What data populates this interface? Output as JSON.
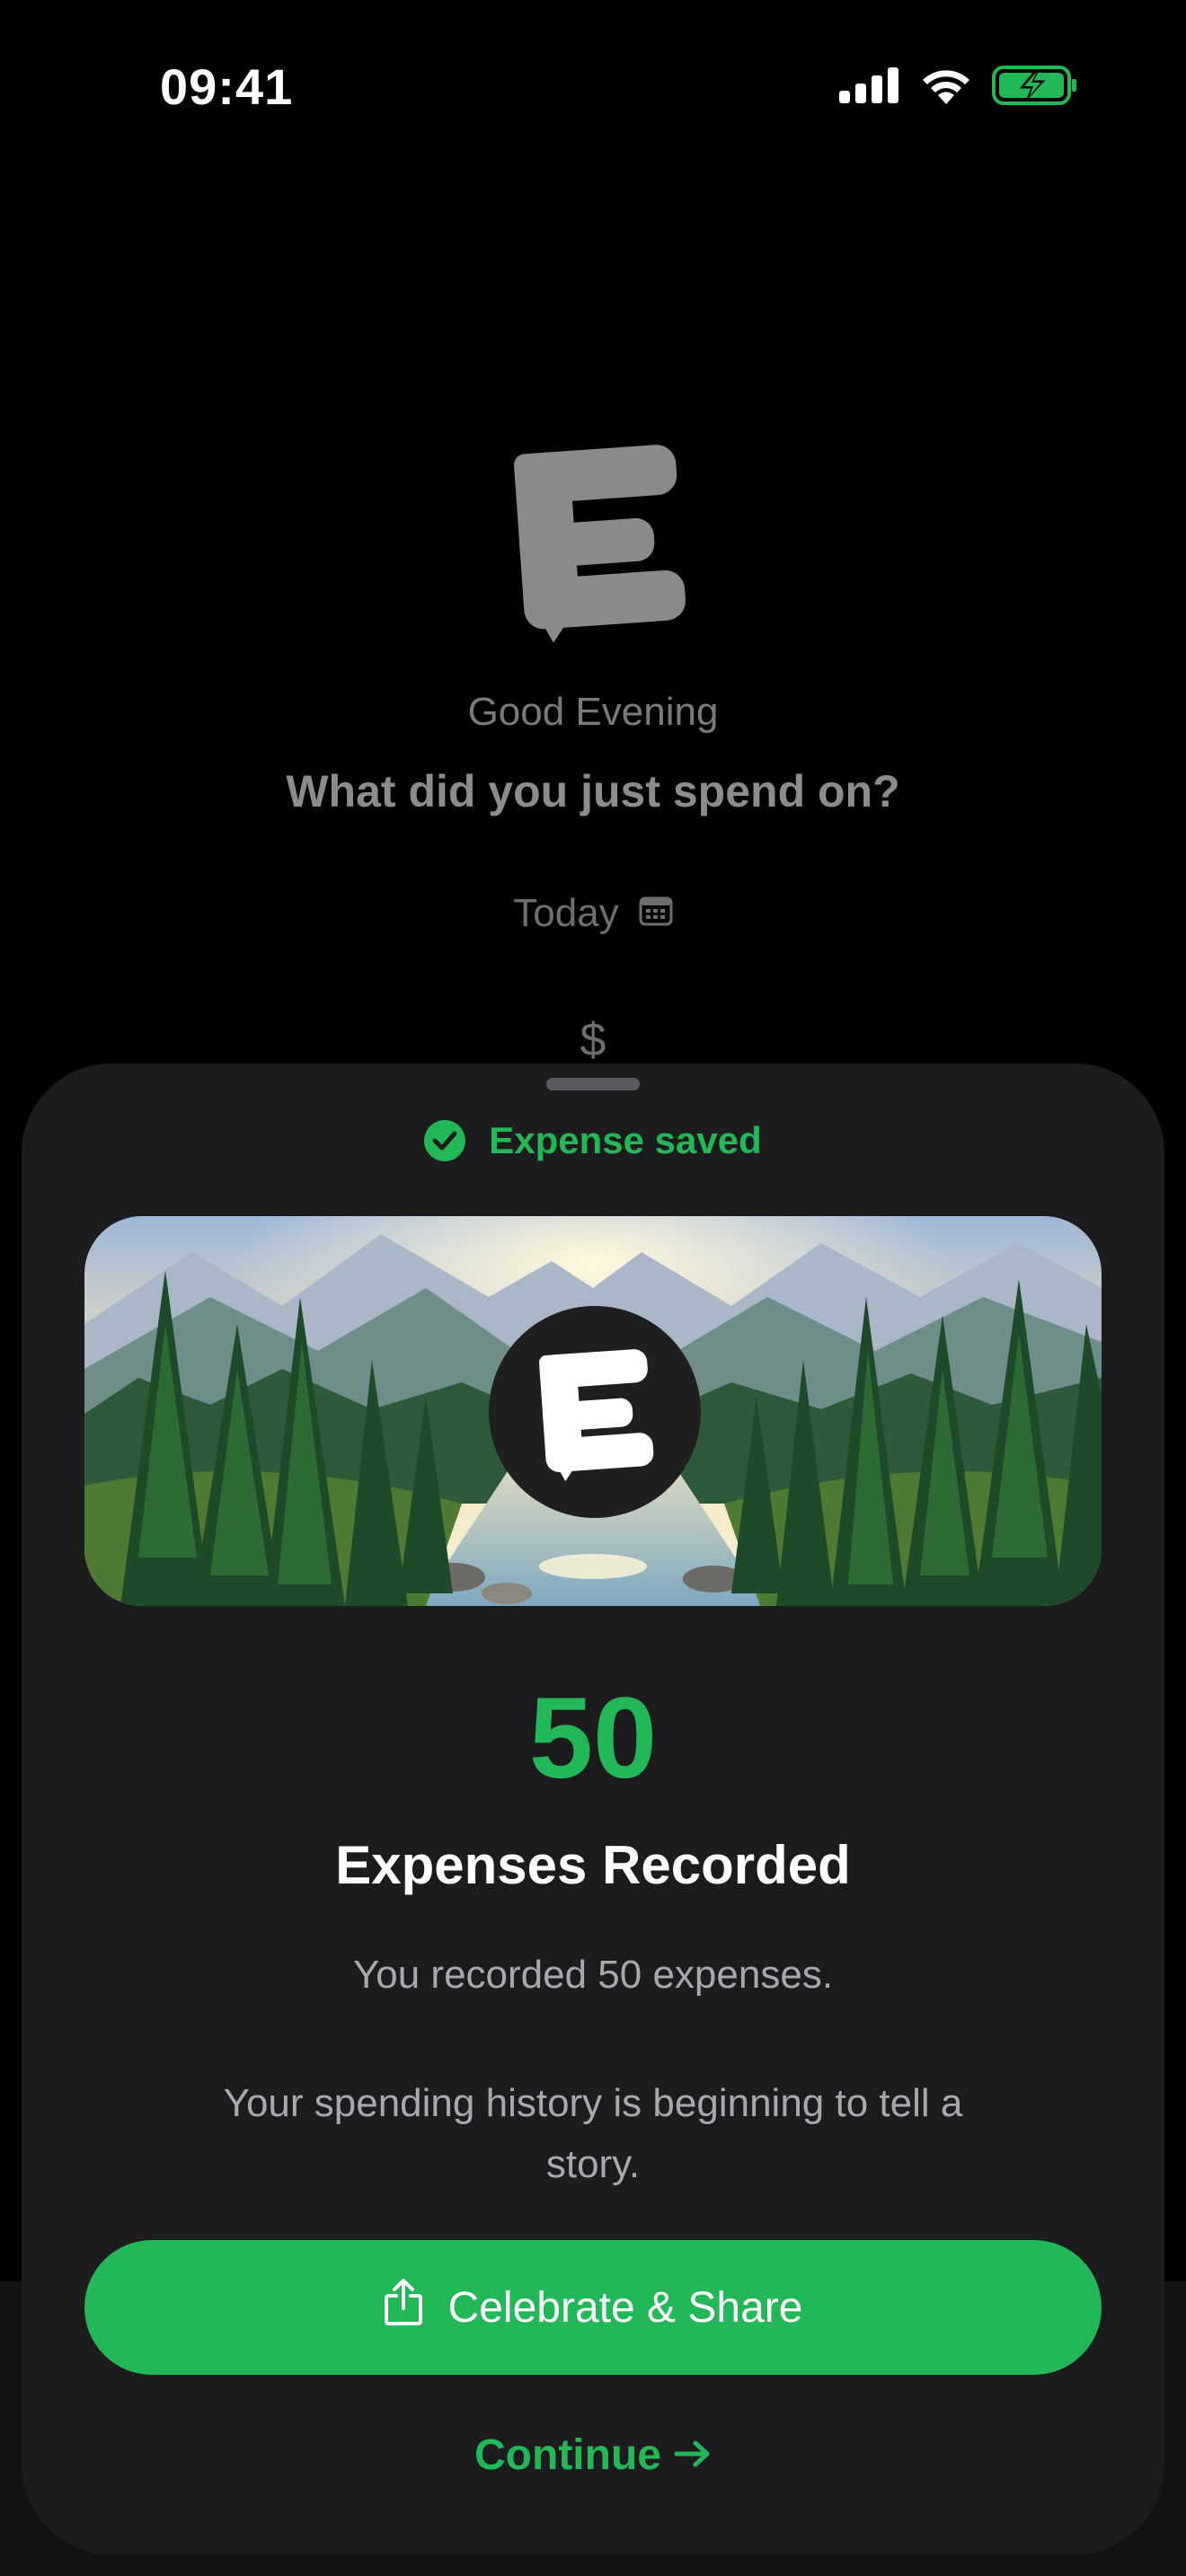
{
  "status_bar": {
    "time": "09:41",
    "icons": [
      "signal-icon",
      "wifi-icon",
      "battery-charging-icon"
    ]
  },
  "background": {
    "greeting": "Good Evening",
    "question": "What did you just spend on?",
    "date_label": "Today",
    "date_icon": "calendar-icon",
    "currency_symbol": "$"
  },
  "sheet": {
    "saved_label": "Expense saved",
    "saved_icon": "checkmark-circle-icon",
    "banner_icon": "app-logo-icon",
    "count": "50",
    "heading": "Expenses Recorded",
    "description": "You recorded 50 expenses.",
    "story": "Your spending history is beginning to tell a story.",
    "share_button_label": "Celebrate & Share",
    "share_icon": "share-icon",
    "continue_label": "Continue",
    "continue_icon": "arrow-right-icon"
  },
  "colors": {
    "accent": "#22b857",
    "sheet_background": "#1c1c1e",
    "screen_background": "#000000"
  }
}
